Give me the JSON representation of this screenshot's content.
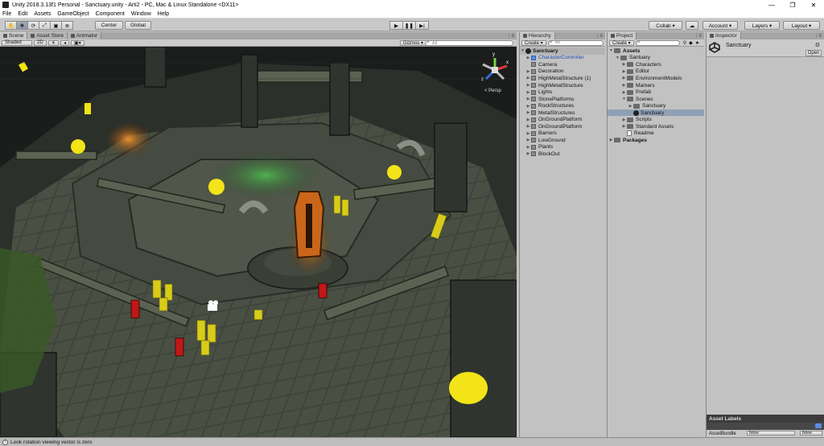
{
  "window": {
    "title": "Unity 2018.3.13f1 Personal - Sanctuary.unity - Arti2 - PC, Mac & Linux Standalone <DX11>"
  },
  "menu": [
    "File",
    "Edit",
    "Assets",
    "GameObject",
    "Component",
    "Window",
    "Help"
  ],
  "toolbar": {
    "pivot_label": "Center",
    "space_label": "Global",
    "collab_label": "Collab ▾",
    "account_label": "Account ▾",
    "layers_label": "Layers ▾",
    "layout_label": "Layout ▾"
  },
  "scene": {
    "tabs": [
      "Scene",
      "Asset Store",
      "Animator"
    ],
    "shading": "Shaded",
    "mode_2d": "2D",
    "gizmos_label": "Gizmos ▾",
    "search_placeholder": "All",
    "persp_label": "< Persp",
    "gizmo_axes": [
      "y",
      "x",
      "z"
    ]
  },
  "hierarchy": {
    "tab": "Hierarchy",
    "create_label": "Create ▾",
    "search_placeholder": "All",
    "root": "Sanctuary",
    "items": [
      "CharacterController",
      "Camera",
      "Decoration",
      "HighMetalStructure (1)",
      "HighMetalStructure",
      "Lights",
      "StonePlatforms",
      "RockStructures",
      "MetalStructures",
      "OnGroundPlatform",
      "OnGroundPlatform",
      "Barriers",
      "LowGround",
      "Plants",
      "BlockOut"
    ]
  },
  "project": {
    "tab": "Project",
    "create_label": "Create ▾",
    "tree": [
      {
        "label": "Assets",
        "level": 0,
        "bold": true,
        "type": "folder"
      },
      {
        "label": "Santuary",
        "level": 1,
        "type": "folder"
      },
      {
        "label": "Characters",
        "level": 2,
        "type": "folder"
      },
      {
        "label": "Editor",
        "level": 2,
        "type": "folder"
      },
      {
        "label": "EnvironmentModels",
        "level": 2,
        "type": "folder"
      },
      {
        "label": "Markers",
        "level": 2,
        "type": "folder"
      },
      {
        "label": "Prefab",
        "level": 2,
        "type": "folder"
      },
      {
        "label": "Scenes",
        "level": 2,
        "type": "folder"
      },
      {
        "label": "Sanctuary",
        "level": 3,
        "type": "folder"
      },
      {
        "label": "Sanctuary",
        "level": 3,
        "type": "scene",
        "selected": true
      },
      {
        "label": "Scripts",
        "level": 2,
        "type": "folder"
      },
      {
        "label": "Standard Assets",
        "level": 2,
        "type": "folder"
      },
      {
        "label": "Readme",
        "level": 2,
        "type": "file"
      },
      {
        "label": "Packages",
        "level": 0,
        "bold": true,
        "type": "folder"
      }
    ]
  },
  "inspector": {
    "tab": "Inspector",
    "asset_name": "Sanctuary",
    "open_label": "Open",
    "asset_labels": "Asset Labels",
    "asset_bundle_label": "AssetBundle",
    "bundle_value": "None",
    "variant_value": "None"
  },
  "status": {
    "message": "Look rotation viewing vector is zero"
  }
}
